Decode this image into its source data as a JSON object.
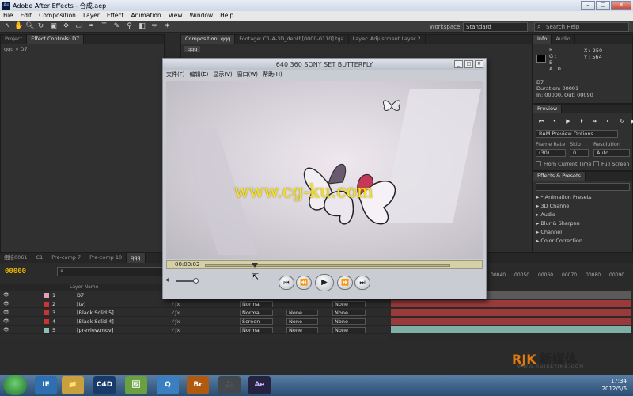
{
  "window": {
    "title": "Adobe After Effects - 合成.aep",
    "app_icon_label": "Ae"
  },
  "menu": [
    "File",
    "Edit",
    "Composition",
    "Layer",
    "Effect",
    "Animation",
    "View",
    "Window",
    "Help"
  ],
  "toolbar": {
    "workspace_label": "Workspace:",
    "workspace_value": "Standard",
    "search_placeholder": "Search Help"
  },
  "project_panel": {
    "tabs": [
      "Project",
      "Effect Controls: D7"
    ],
    "breadcrumb": "qqq » D7"
  },
  "comp_panel": {
    "tabs": [
      "Composition: qqq",
      "Footage: C1-A-3D_depth[0000-0110].tga",
      "Layer: Adjustment Layer 2"
    ],
    "sub_tab": "qqq"
  },
  "info_panel": {
    "tabs": [
      "Info",
      "Audio"
    ],
    "rgb": [
      "R :",
      "G :",
      "B :",
      "A : 0"
    ],
    "x": "X : 250",
    "y": "Y : 564",
    "layer_name": "D7",
    "duration": "Duration: 00091",
    "inout": "In: 00000, Out: 00090"
  },
  "preview_panel": {
    "tab": "Preview",
    "ram_options": "RAM Preview Options",
    "frame_rate_label": "Frame Rate",
    "skip_label": "Skip",
    "resolution_label": "Resolution",
    "frame_rate": "(30)",
    "skip": "0",
    "resolution": "Auto",
    "from_current": "From Current Time",
    "full_screen": "Full Screen"
  },
  "effects_panel": {
    "tab": "Effects & Presets",
    "items": [
      "* Animation Presets",
      "3D Channel",
      "Audio",
      "Blur & Sharpen",
      "Channel",
      "Color Correction"
    ]
  },
  "timeline": {
    "tabs": [
      "组接0061",
      "C1",
      "Pre-comp 7",
      "Pre-comp 10",
      "qqq"
    ],
    "timecode": "00000",
    "ruler": [
      "00040",
      "00050",
      "00060",
      "00070",
      "00080",
      "00090"
    ],
    "layer_header": "Layer Name",
    "layers": [
      {
        "num": "1",
        "name": "D7",
        "mode": "",
        "trk": "",
        "parent": "",
        "color": "#e6a0b8",
        "bar": "#5a5a5a"
      },
      {
        "num": "2",
        "name": "[tv]",
        "mode": "Normal",
        "trk": "",
        "parent": "None",
        "color": "#cc3333",
        "bar": "#9a3a3a"
      },
      {
        "num": "3",
        "name": "[Black Solid 5]",
        "mode": "Normal",
        "trk": "None",
        "parent": "None",
        "color": "#cc3333",
        "bar": "#9a3a3a"
      },
      {
        "num": "4",
        "name": "[Black Solid 4]",
        "mode": "Screen",
        "trk": "None",
        "parent": "None",
        "color": "#cc3333",
        "bar": "#9a3a3a"
      },
      {
        "num": "5",
        "name": "[preview.mov]",
        "mode": "Normal",
        "trk": "None",
        "parent": "None",
        "color": "#8fbfb3",
        "bar": "#7fb0a6"
      }
    ]
  },
  "player": {
    "title": "640 360 SONY SET BUTTERFLY",
    "menu": [
      "文件(F)",
      "编辑(E)",
      "显示(V)",
      "窗口(W)",
      "帮助(H)"
    ],
    "watermark": "www.cg-ku.com",
    "time": "00:00:02",
    "progress": 0.2,
    "buttons": [
      "⏮",
      "⏪",
      "▶",
      "⏩",
      "⏭"
    ]
  },
  "brand": {
    "logo": "RJK",
    "name": "新媒体",
    "url": "WWW.RUIKETIME.COM"
  },
  "taskbar": {
    "apps": [
      "IE",
      "📁",
      "C4D",
      "🖼",
      "Q",
      "Br",
      "🎥",
      "Ae"
    ],
    "time": "17:34",
    "date": "2012/5/6"
  },
  "colors": {
    "accent": "#e8b400",
    "taskbar": "#3a6088",
    "watermark": "#f4e21a"
  }
}
